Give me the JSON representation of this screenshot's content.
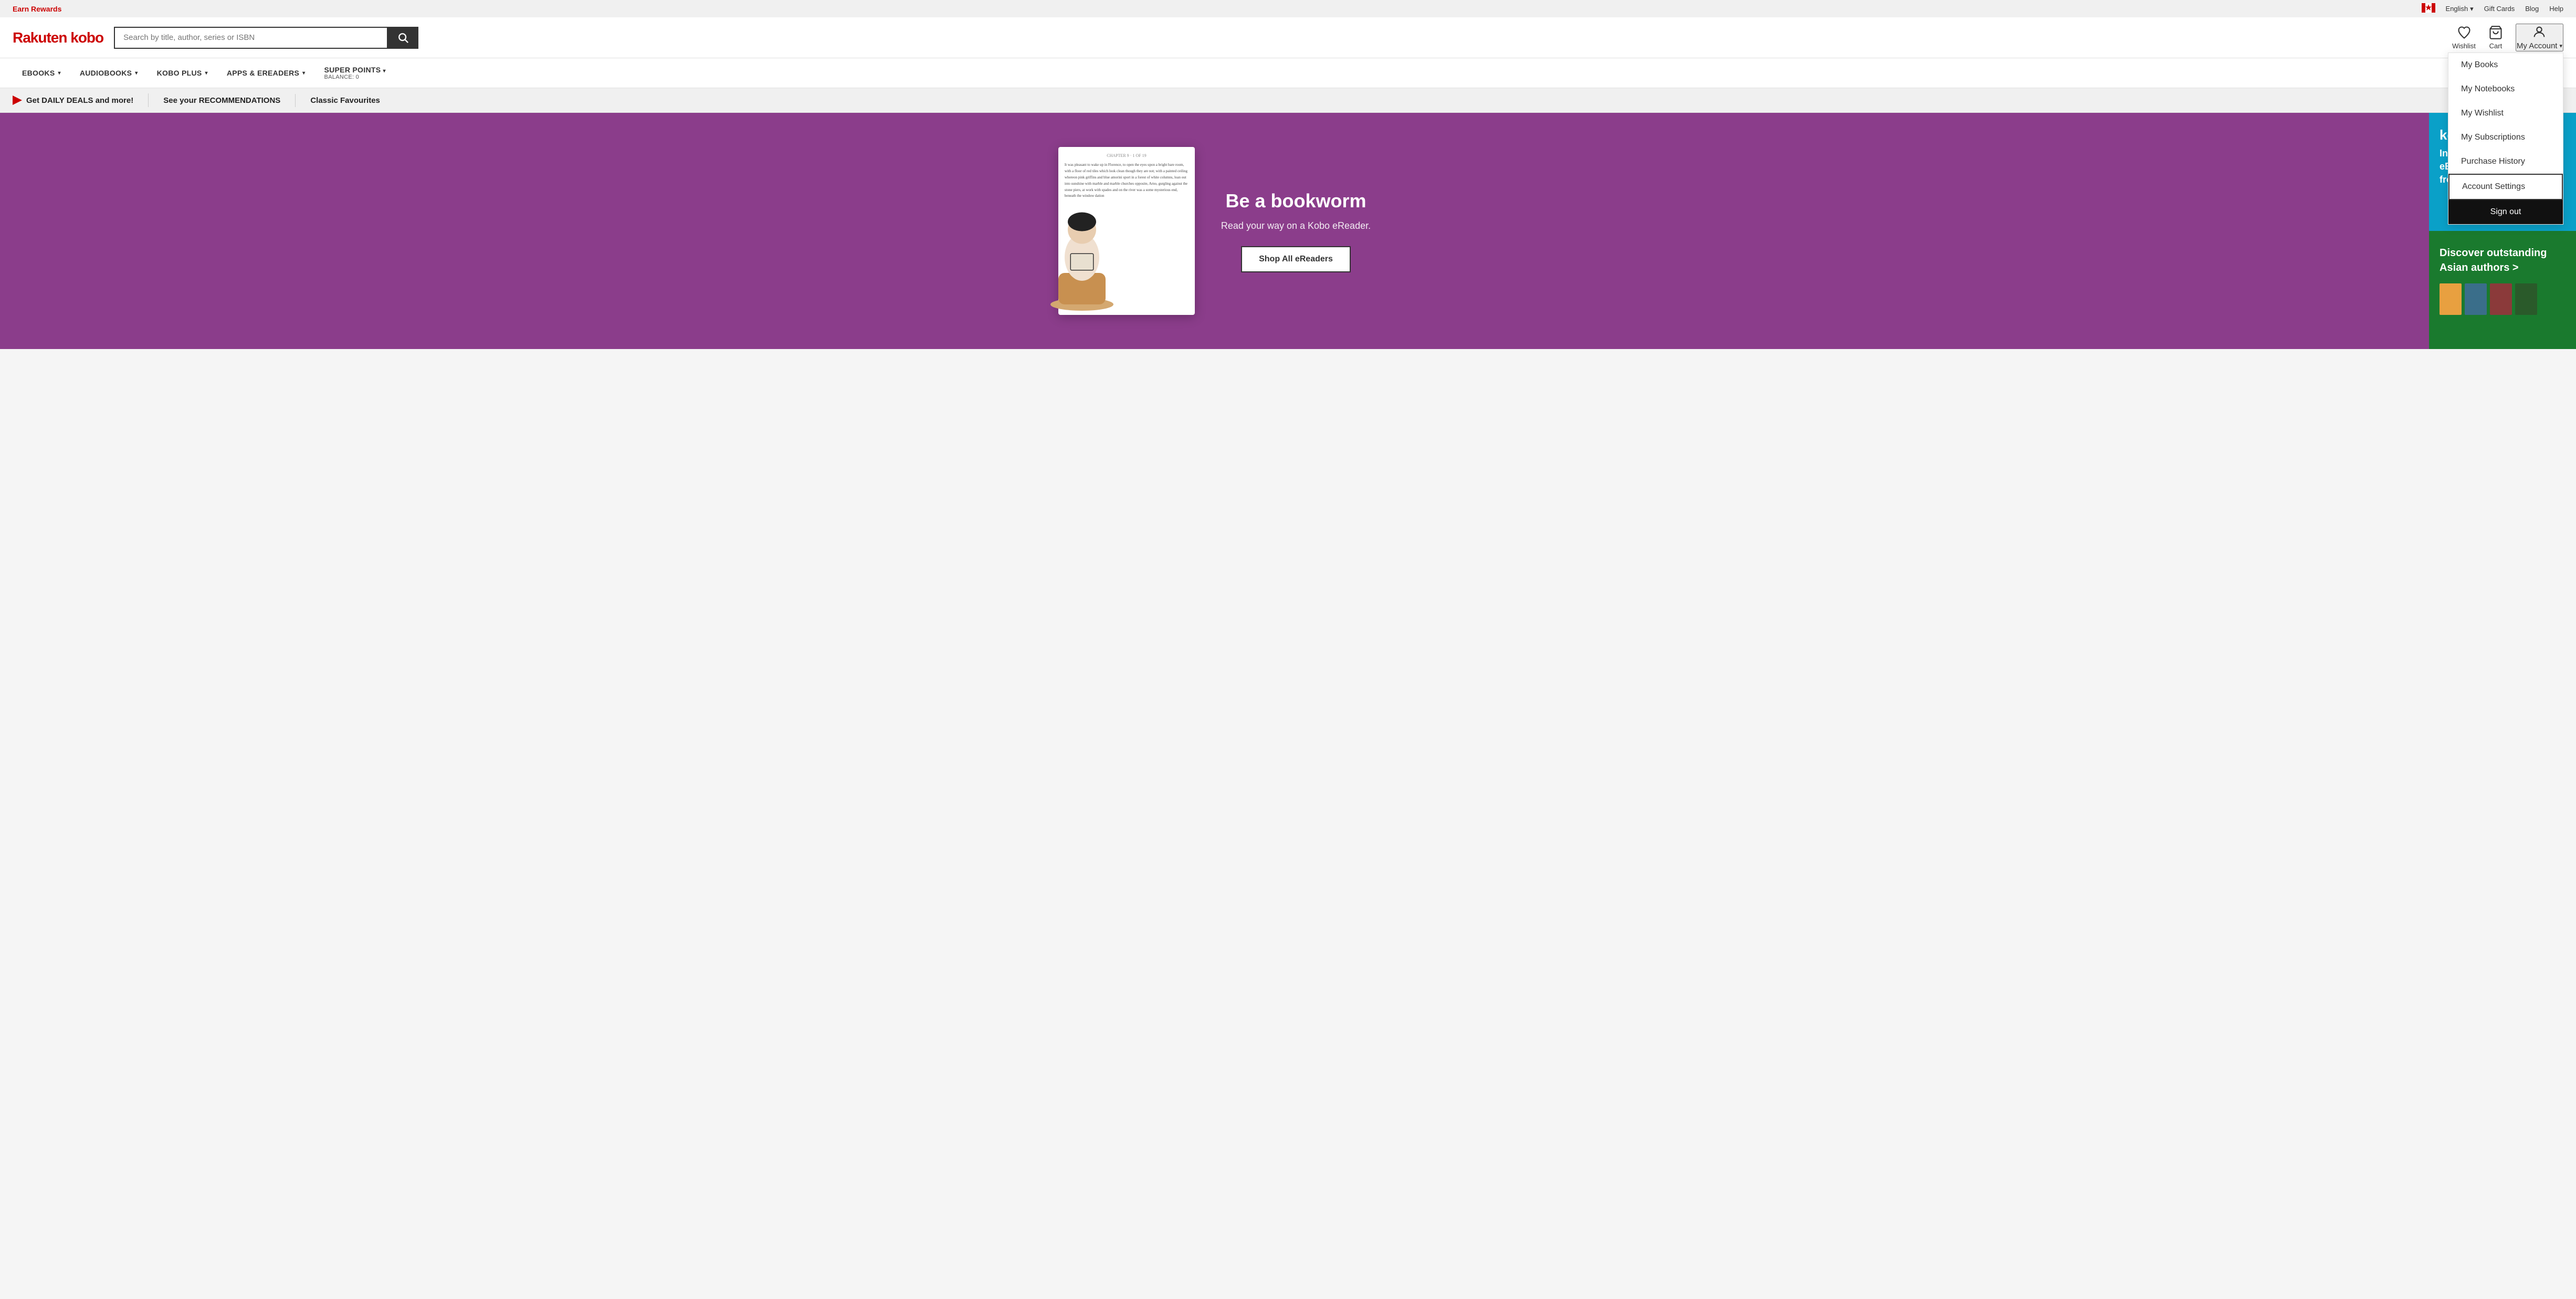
{
  "topbar": {
    "earn_rewards": "Earn Rewards",
    "language": "English",
    "chevron": "▾",
    "gift_cards": "Gift Cards",
    "blog": "Blog",
    "help": "Help"
  },
  "header": {
    "logo_text": "Rakuten kobo",
    "search_placeholder": "Search by title, author, series or ISBN",
    "wishlist_label": "Wishlist",
    "cart_label": "Cart",
    "my_account_label": "My Account",
    "my_account_chevron": "▾"
  },
  "account_dropdown": {
    "my_books": "My Books",
    "my_notebooks": "My Notebooks",
    "my_wishlist": "My Wishlist",
    "my_subscriptions": "My Subscriptions",
    "purchase_history": "Purchase History",
    "account_settings": "Account Settings",
    "sign_out": "Sign out"
  },
  "nav": {
    "ebooks": "eBOOKS",
    "audiobooks": "AUDIOBOOKS",
    "kobo_plus": "KOBO PLUS",
    "apps_ereaders": "APPS & eREADERS",
    "super_points": "SUPER POINTS",
    "balance_label": "Balance: 0"
  },
  "promo_bar": {
    "daily_deals": "Get DAILY DEALS and more!",
    "recommendations": "See your RECOMMENDATIONS",
    "classic_favourites": "Classic Favourites"
  },
  "hero": {
    "title": "Be a bookworm",
    "subtitle": "Read your way on a Kobo eReader.",
    "cta": "Shop All eReaders",
    "device_chapter": "CHAPTER 9 · 1 OF 19",
    "device_text": "It was pleasant to wake up in Florence, to open the eyes upon a bright bare room, with a floor of red tiles which look clean though they are not; with a painted ceiling whereon pink griffins and blue amorini sport in a forest of white columns, loan out into sunshine with marble and marble churches opposite, Arno, gurgling against the stone piers, at work with spades and on the river was a some mysterious end, beneath the window dation"
  },
  "panel_kobo": {
    "title": "kobo p",
    "line1": "Indulge",
    "line2": "eBooks",
    "line3": "from $9"
  },
  "panel_asian": {
    "title": "Discover outstanding Asian authors >"
  },
  "colors": {
    "red": "#cc0000",
    "hero_bg": "#8b3d8b",
    "kobo_plus_bg": "#0aa0c8",
    "asian_bg": "#1a7a2e",
    "dark": "#111111",
    "highlight_border": "#333333"
  }
}
